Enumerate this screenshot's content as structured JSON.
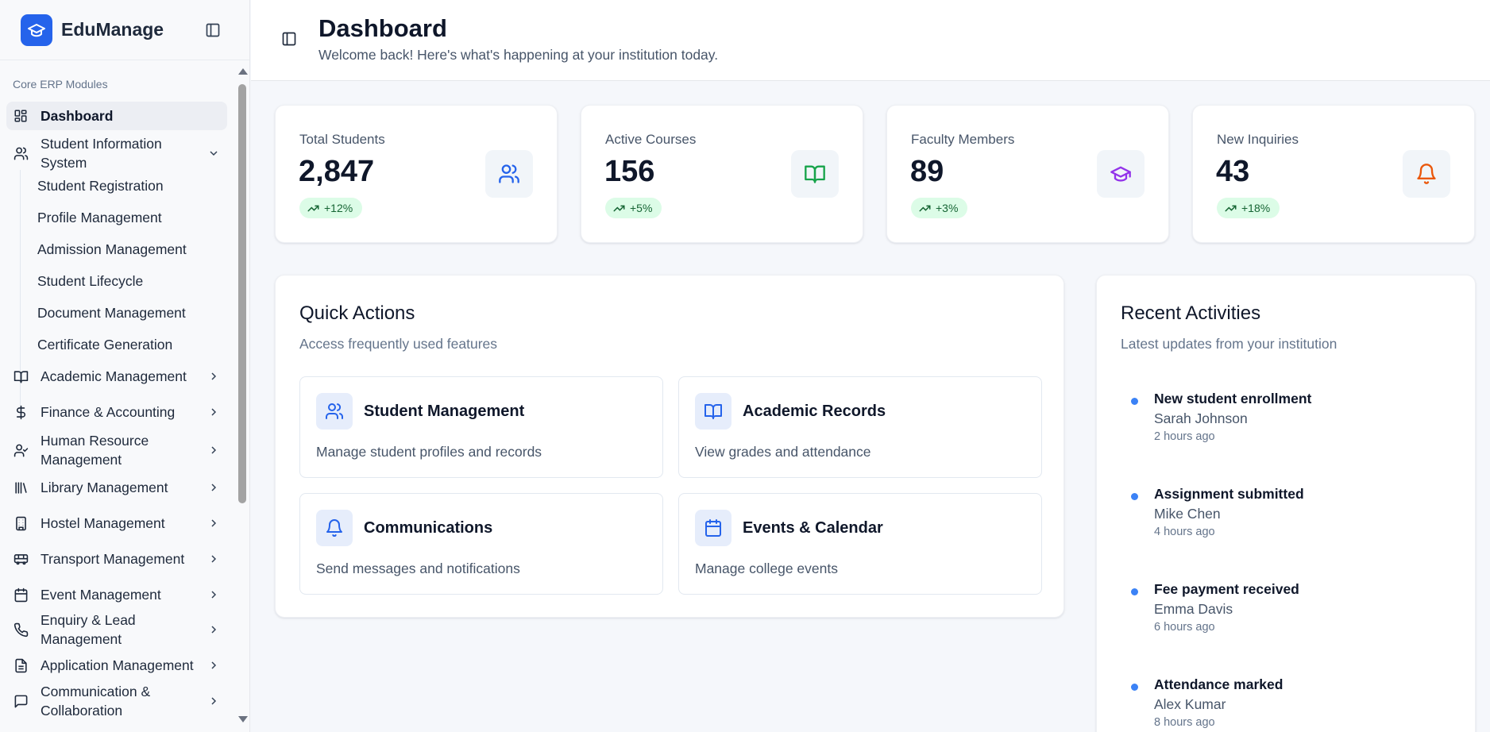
{
  "app": {
    "name": "EduManage"
  },
  "sidebar": {
    "section_label": "Core ERP Modules",
    "dashboard": "Dashboard",
    "student_info": {
      "label": "Student Information System",
      "subitems": [
        "Student Registration",
        "Profile Management",
        "Admission Management",
        "Student Lifecycle",
        "Document Management",
        "Certificate Generation"
      ]
    },
    "modules": [
      {
        "label": "Academic Management",
        "icon": "book-icon"
      },
      {
        "label": "Finance & Accounting",
        "icon": "dollar-icon"
      },
      {
        "label": "Human Resource Management",
        "icon": "user-check-icon"
      },
      {
        "label": "Library Management",
        "icon": "library-icon"
      },
      {
        "label": "Hostel Management",
        "icon": "building-icon"
      },
      {
        "label": "Transport Management",
        "icon": "bus-icon"
      },
      {
        "label": "Event Management",
        "icon": "calendar-icon"
      },
      {
        "label": "Enquiry & Lead Management",
        "icon": "phone-icon"
      },
      {
        "label": "Application Management",
        "icon": "file-icon"
      },
      {
        "label": "Communication & Collaboration",
        "icon": "message-icon"
      }
    ]
  },
  "header": {
    "title": "Dashboard",
    "subtitle": "Welcome back! Here's what's happening at your institution today."
  },
  "stats": [
    {
      "label": "Total Students",
      "value": "2,847",
      "change": "+12%",
      "icon": "users-icon",
      "color": "#2563eb"
    },
    {
      "label": "Active Courses",
      "value": "156",
      "change": "+5%",
      "icon": "book-open-icon",
      "color": "#16a34a"
    },
    {
      "label": "Faculty Members",
      "value": "89",
      "change": "+3%",
      "icon": "graduation-cap-icon",
      "color": "#9333ea"
    },
    {
      "label": "New Inquiries",
      "value": "43",
      "change": "+18%",
      "icon": "bell-icon",
      "color": "#ea580c"
    }
  ],
  "quick_actions": {
    "title": "Quick Actions",
    "subtitle": "Access frequently used features",
    "items": [
      {
        "title": "Student Management",
        "desc": "Manage student profiles and records",
        "icon": "users-icon"
      },
      {
        "title": "Academic Records",
        "desc": "View grades and attendance",
        "icon": "book-open-icon"
      },
      {
        "title": "Communications",
        "desc": "Send messages and notifications",
        "icon": "bell-icon"
      },
      {
        "title": "Events & Calendar",
        "desc": "Manage college events",
        "icon": "calendar-icon"
      }
    ]
  },
  "recent_activities": {
    "title": "Recent Activities",
    "subtitle": "Latest updates from your institution",
    "items": [
      {
        "title": "New student enrollment",
        "user": "Sarah Johnson",
        "time": "2 hours ago"
      },
      {
        "title": "Assignment submitted",
        "user": "Mike Chen",
        "time": "4 hours ago"
      },
      {
        "title": "Fee payment received",
        "user": "Emma Davis",
        "time": "6 hours ago"
      },
      {
        "title": "Attendance marked",
        "user": "Alex Kumar",
        "time": "8 hours ago"
      }
    ]
  },
  "colors": {
    "brand": "#2563eb",
    "badge_bg": "#dcfce7",
    "badge_text": "#166534",
    "activity_dot": "#3b82f6"
  }
}
